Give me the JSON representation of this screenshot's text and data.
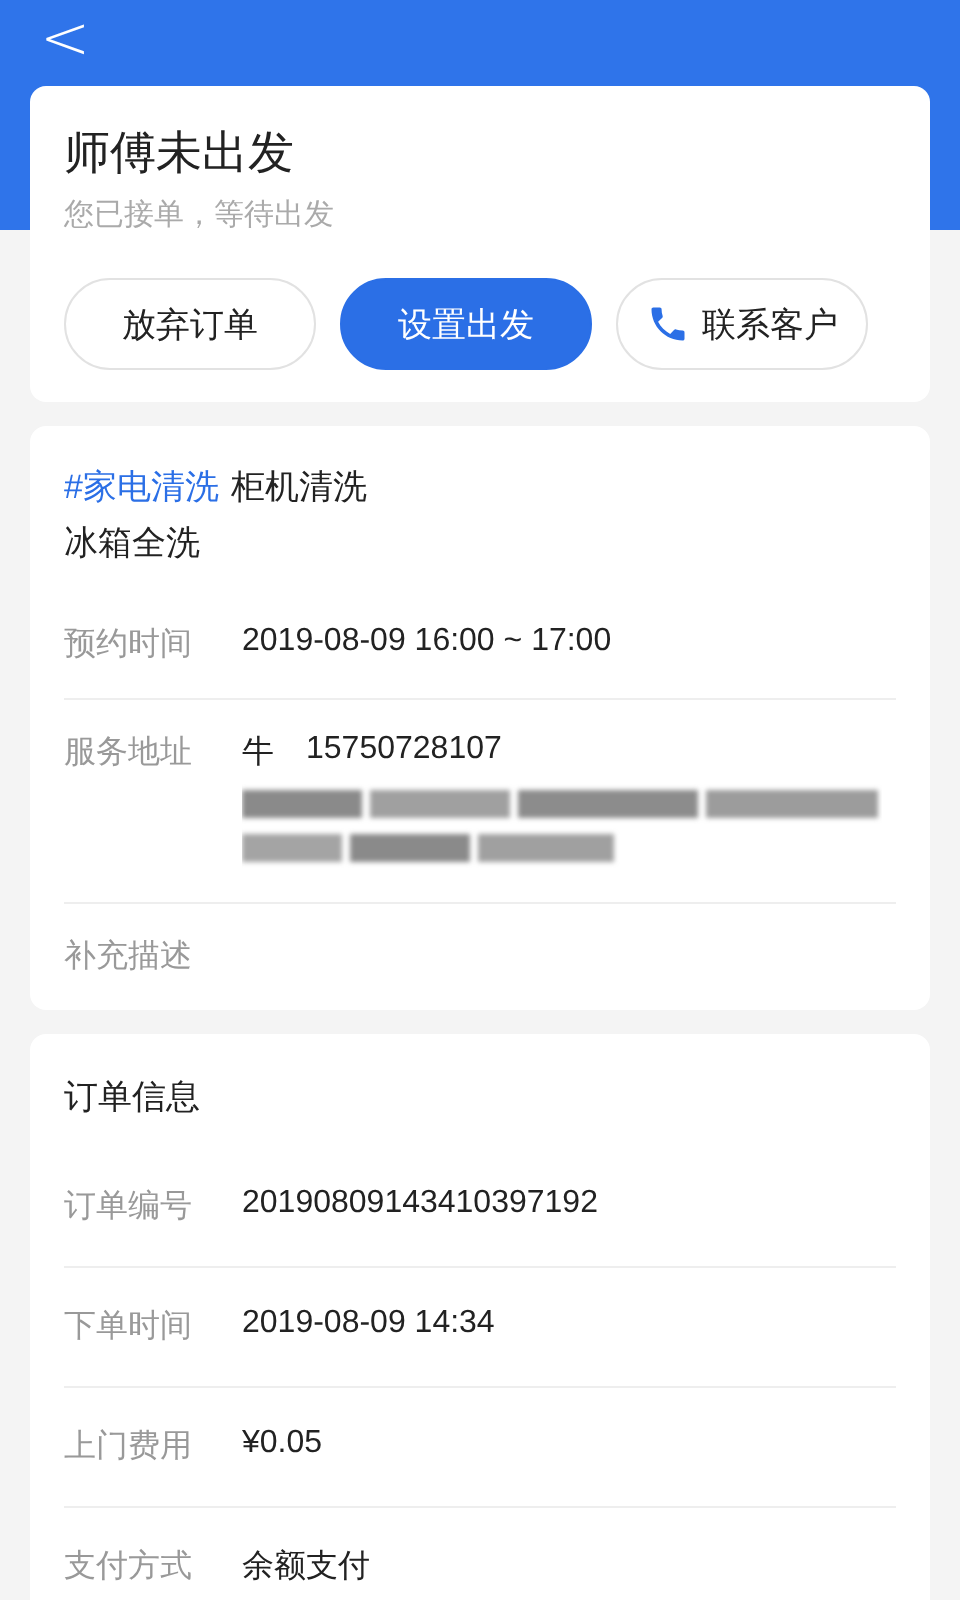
{
  "nav": {
    "back": "<"
  },
  "status": {
    "title": "师傅未出发",
    "subtitle": "您已接单，等待出发",
    "buttons": [
      {
        "kind": "outline",
        "label": "放弃订单"
      },
      {
        "kind": "primary",
        "label": "设置出发"
      },
      {
        "kind": "phone",
        "label": "联系客户"
      }
    ]
  },
  "service": {
    "tag": "#家电清洗",
    "title_lines": [
      "柜机清洗",
      "冰箱全洗"
    ],
    "rows": [
      {
        "kind": "text",
        "label": "预约时间",
        "value": "2019-08-09 16:00 ~ 17:00"
      },
      {
        "kind": "address",
        "label": "服务地址",
        "name": "牛",
        "phone": "15750728107"
      },
      {
        "kind": "empty",
        "label": "补充描述"
      }
    ]
  },
  "order": {
    "title": "订单信息",
    "rows": [
      {
        "kind": "text",
        "label": "订单编号",
        "value": "20190809143410397192"
      },
      {
        "kind": "text",
        "label": "下单时间",
        "value": "2019-08-09 14:34"
      },
      {
        "kind": "text",
        "label": "上门费用",
        "value": "¥0.05"
      },
      {
        "kind": "text",
        "label": "支付方式",
        "value": "余额支付"
      }
    ]
  }
}
